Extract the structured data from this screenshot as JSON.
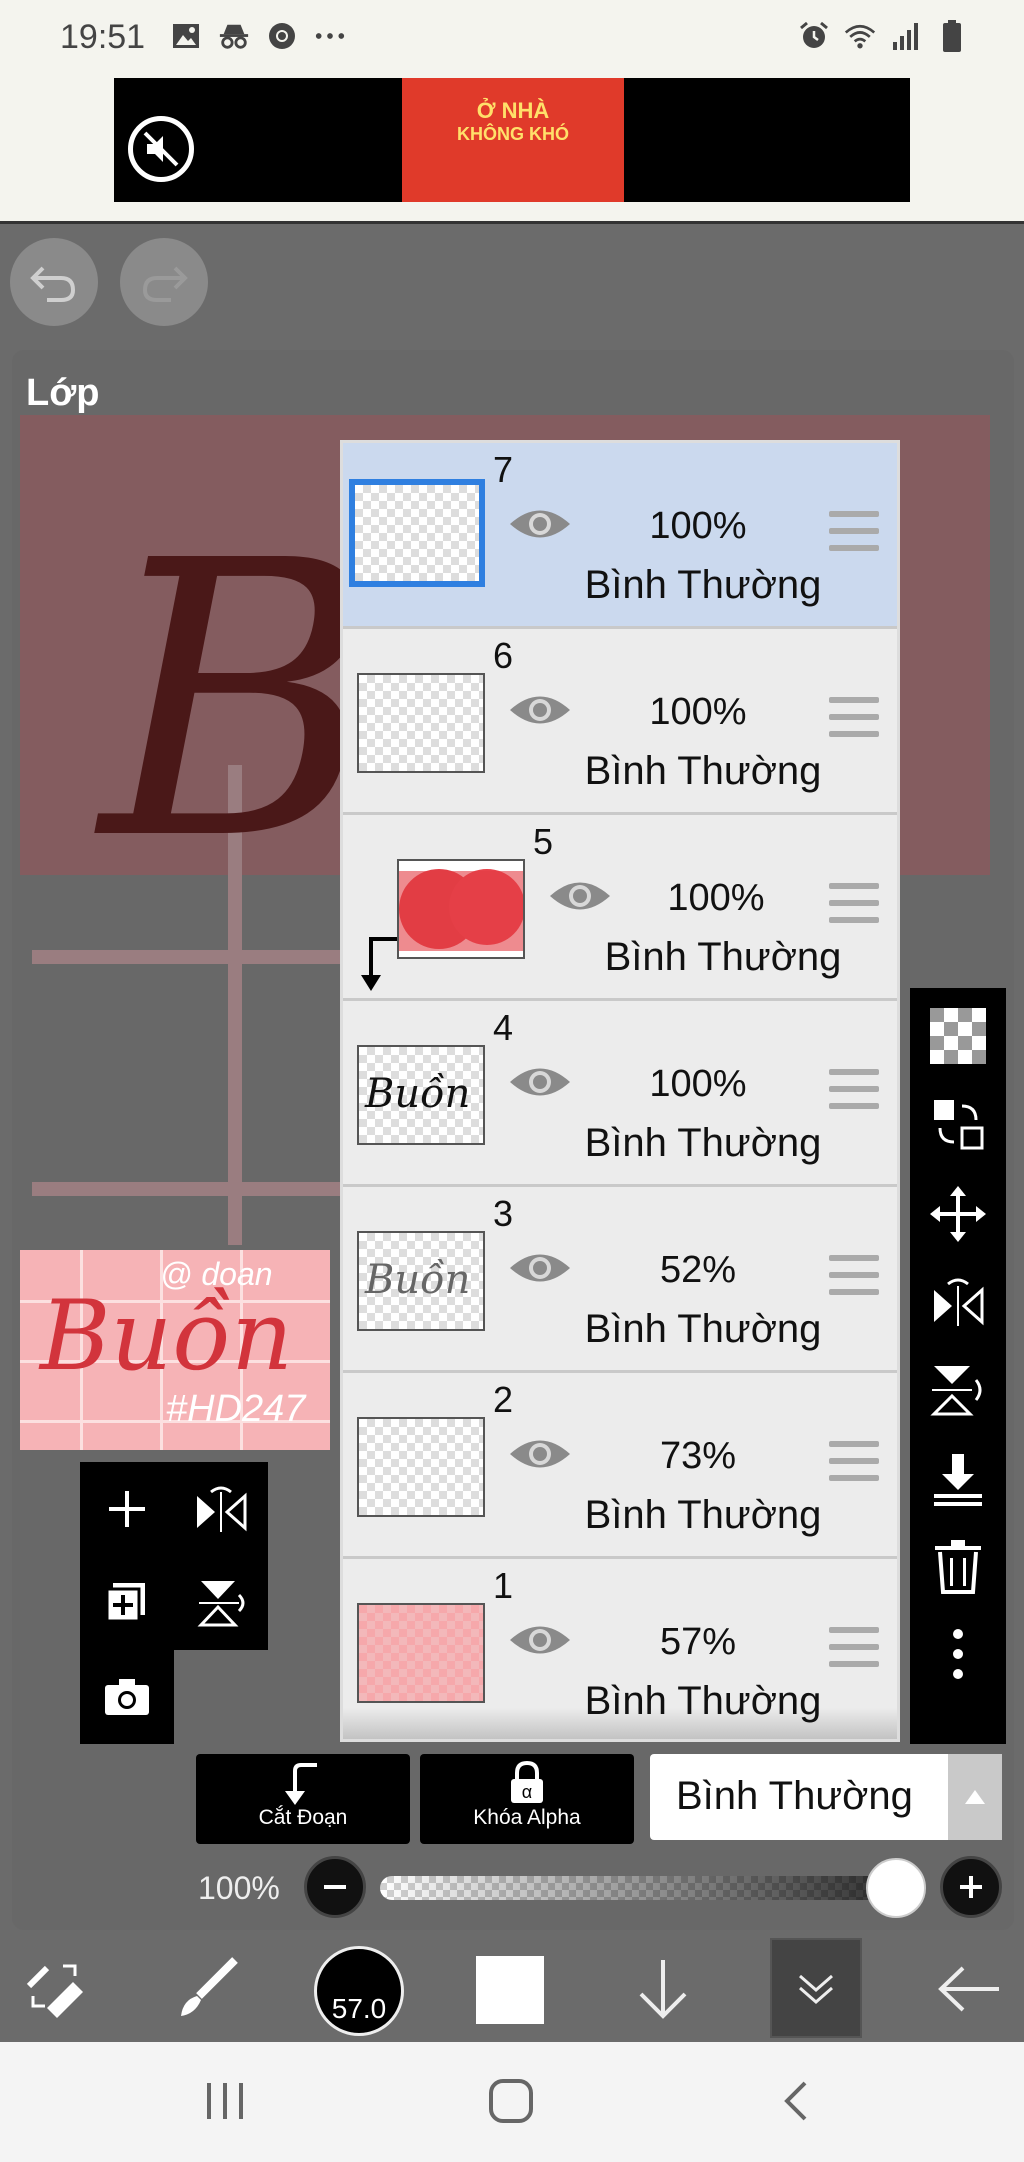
{
  "status_bar": {
    "time": "19:51",
    "left_icons": [
      "image-icon",
      "incognito-icon",
      "chrome-icon",
      "more-dots-icon"
    ],
    "right_icons": [
      "alarm-icon",
      "wifi-icon",
      "signal-icon",
      "battery-icon"
    ]
  },
  "ad": {
    "line1": "Ở NHÀ",
    "line2": "KHÔNG KHÓ",
    "mute_icon": "mute-icon"
  },
  "panel": {
    "title": "Lớp"
  },
  "preview": {
    "handle": "@ doan",
    "word": "Buồn",
    "tag": "#HD247"
  },
  "layers": [
    {
      "num": "7",
      "opacity": "100%",
      "mode": "Bình Thường",
      "thumb": "empty",
      "selected": true
    },
    {
      "num": "6",
      "opacity": "100%",
      "mode": "Bình Thường",
      "thumb": "empty",
      "selected": false
    },
    {
      "num": "5",
      "opacity": "100%",
      "mode": "Bình Thường",
      "thumb": "red",
      "selected": false,
      "clipped": true
    },
    {
      "num": "4",
      "opacity": "100%",
      "mode": "Bình Thường",
      "thumb": "text",
      "thumb_text": "Buồn",
      "selected": false
    },
    {
      "num": "3",
      "opacity": "52%",
      "mode": "Bình Thường",
      "thumb": "text-faint",
      "thumb_text": "Buồn",
      "selected": false
    },
    {
      "num": "2",
      "opacity": "73%",
      "mode": "Bình Thường",
      "thumb": "empty",
      "selected": false
    },
    {
      "num": "1",
      "opacity": "57%",
      "mode": "Bình Thường",
      "thumb": "pink",
      "selected": false
    }
  ],
  "bottom_controls": {
    "clip_label": "Cắt Đoạn",
    "alpha_lock_label": "Khóa Alpha",
    "blend_mode": "Bình Thường",
    "opacity_label": "100%",
    "opacity_value": 1.0
  },
  "main_toolbar": {
    "brush_size": "57.0",
    "primary_color": "#ffffff"
  },
  "colors": {
    "selected_layer": "#cbd9ee",
    "selected_border": "#2f7fe0",
    "panel_bg": "#686868",
    "accent_red": "#e0373f"
  }
}
